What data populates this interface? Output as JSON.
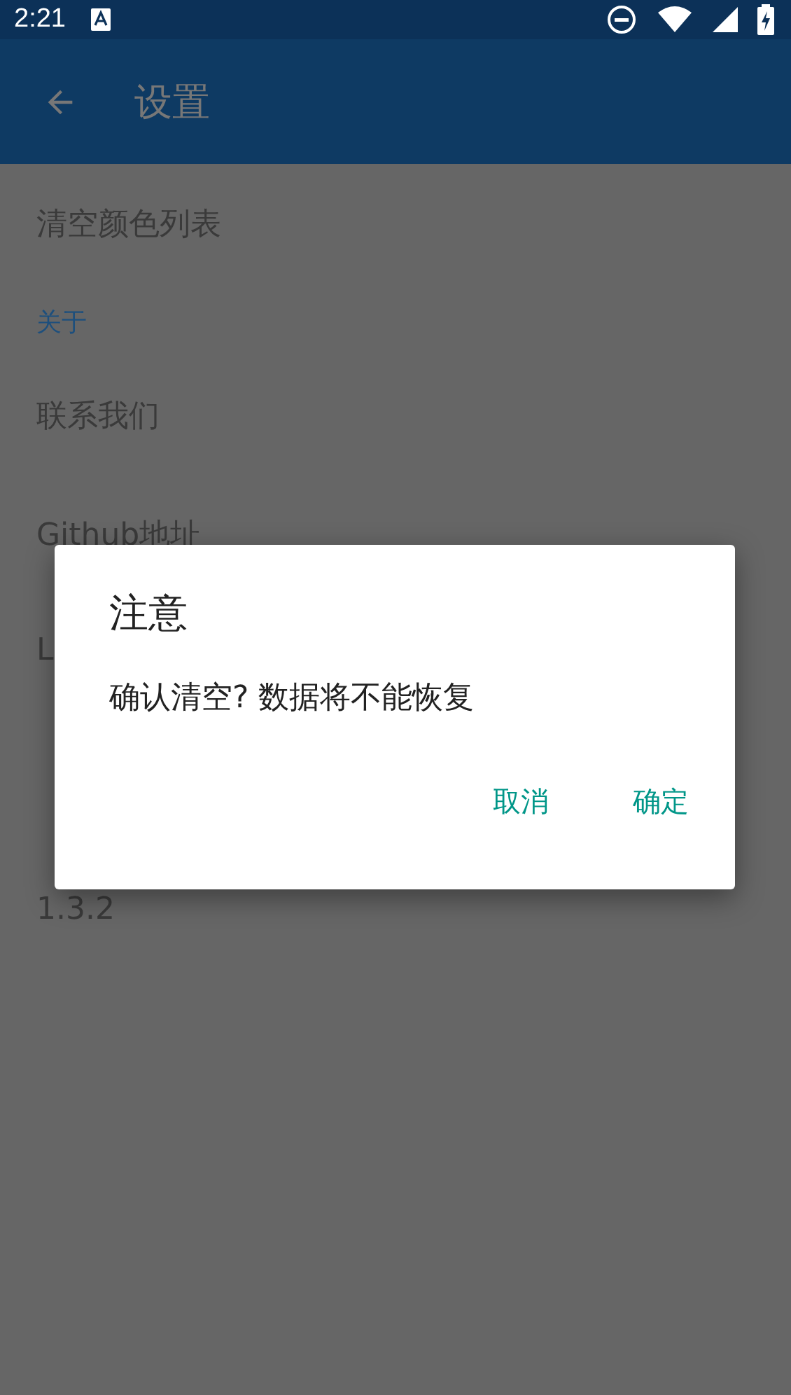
{
  "status_bar": {
    "time": "2:21"
  },
  "toolbar": {
    "title": "设置"
  },
  "settings": [
    {
      "kind": "item",
      "label": "清空颜色列表"
    },
    {
      "kind": "header",
      "label": "关于"
    },
    {
      "kind": "item",
      "label": "联系我们"
    },
    {
      "kind": "item",
      "label": "Github地址"
    },
    {
      "kind": "item",
      "label": "L"
    },
    {
      "kind": "item",
      "label": "1.3.2"
    }
  ],
  "dialog": {
    "title": "注意",
    "message": "确认清空? 数据将不能恢复",
    "buttons": [
      "取消",
      "确定"
    ]
  }
}
